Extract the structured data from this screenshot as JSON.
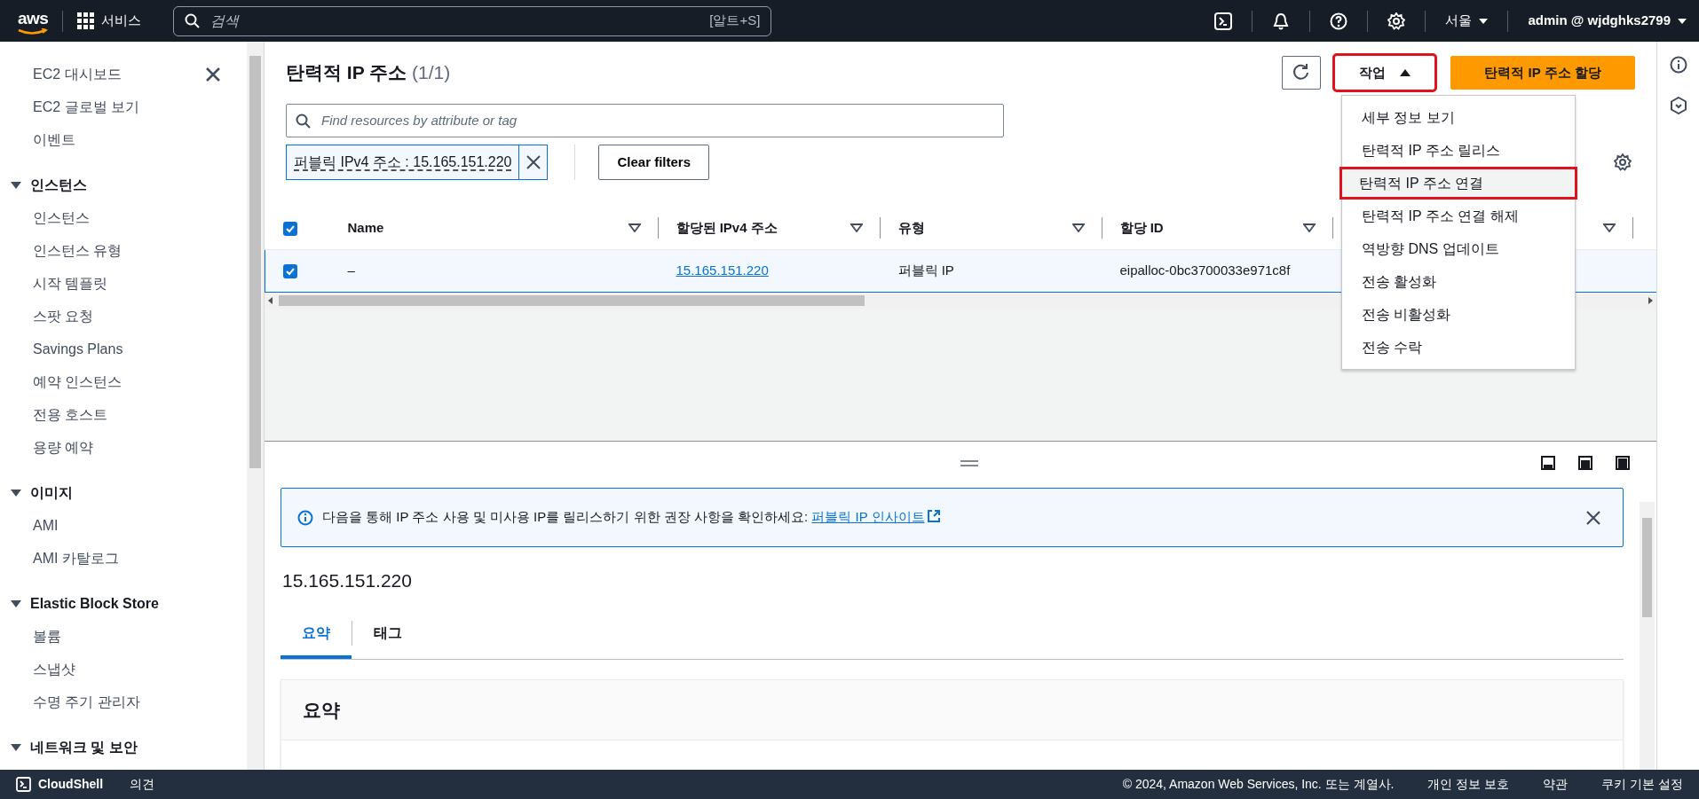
{
  "top_nav": {
    "logo": "aws",
    "services": "서비스",
    "search": {
      "placeholder": "검색",
      "shortcut": "[알트+S]"
    },
    "region": "서울",
    "account": "admin @ wjdghks2799"
  },
  "sidebar": {
    "groups": [
      {
        "items": [
          "EC2 대시보드",
          "EC2 글로벌 보기",
          "이벤트"
        ]
      },
      {
        "title": "인스턴스",
        "expanded": true,
        "items": [
          "인스턴스",
          "인스턴스 유형",
          "시작 템플릿",
          "스팟 요청",
          "Savings Plans",
          "예약 인스턴스",
          "전용 호스트",
          "용량 예약"
        ]
      },
      {
        "title": "이미지",
        "expanded": true,
        "items": [
          "AMI",
          "AMI 카탈로그"
        ]
      },
      {
        "title": "Elastic Block Store",
        "expanded": true,
        "items": [
          "볼륨",
          "스냅샷",
          "수명 주기 관리자"
        ]
      },
      {
        "title": "네트워크 및 보안",
        "expanded": true
      }
    ]
  },
  "page": {
    "title": "탄력적 IP 주소",
    "count": "(1/1)",
    "actions_button": {
      "label": "작업",
      "expanded": true,
      "highlighted": true
    },
    "allocate_button": "탄력적 IP 주소 할당",
    "search": {
      "placeholder": "Find resources by attribute or tag"
    },
    "filter_token": "퍼블릭 IPv4 주소 : 15.165.151.220",
    "clear_filters": "Clear filters"
  },
  "table": {
    "all_checked": true,
    "columns": [
      "Name",
      "할당된 IPv4 주소",
      "유형",
      "할당 ID"
    ],
    "rows": [
      {
        "selected": true,
        "cells": [
          "–",
          "15.165.151.220",
          "퍼블릭 IP",
          "eipalloc-0bc3700033e971c8f"
        ]
      }
    ]
  },
  "actions_menu": {
    "items": [
      {
        "label": "세부 정보 보기",
        "highlighted": false
      },
      {
        "label": "탄력적 IP 주소 릴리스",
        "highlighted": false
      },
      {
        "label": "탄력적 IP 주소 연결",
        "highlighted": true
      },
      {
        "label": "탄력적 IP 주소 연결 해제",
        "highlighted": false
      },
      {
        "label": "역방향 DNS 업데이트",
        "highlighted": false
      },
      {
        "label": "전송 활성화",
        "highlighted": false
      },
      {
        "label": "전송 비활성화",
        "highlighted": false
      },
      {
        "label": "전송 수락",
        "highlighted": false
      }
    ]
  },
  "details": {
    "alert": {
      "text": "다음을 통해 IP 주소 사용 및 미사용 IP를 릴리스하기 위한 권장 사항을 확인하세요:",
      "link": "퍼블릭 IP 인사이트"
    },
    "title": "15.165.151.220",
    "tabs": [
      {
        "label": "요약",
        "selected": true
      },
      {
        "label": "태그",
        "selected": false
      }
    ],
    "summary_title": "요약"
  },
  "footer": {
    "cloudshell": "CloudShell",
    "feedback": "의견",
    "copyright": "© 2024, Amazon Web Services, Inc. 또는 계열사.",
    "links": [
      "개인 정보 보호",
      "약관",
      "쿠키 기본 설정"
    ]
  }
}
